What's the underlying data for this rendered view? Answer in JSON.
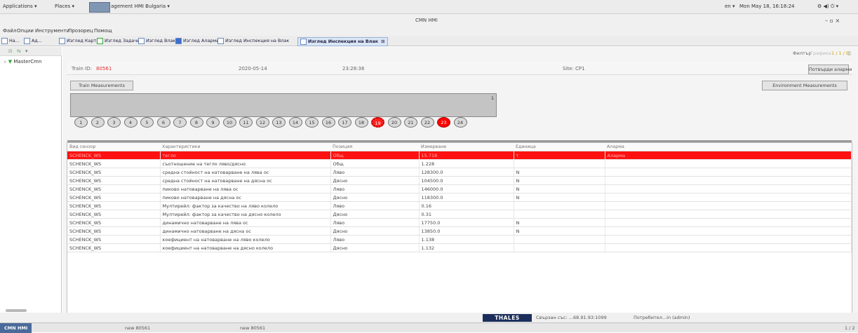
{
  "topbar": {
    "applications": "Applications ▾",
    "places": "Places ▾",
    "window_title": "agement HMI Bulgaria ▾",
    "lang": "en ▾",
    "clock": "Mon May 18, 16:18:24",
    "tray": "⚙ ◀) ⏻ ▾"
  },
  "titlebar": {
    "title": "CMN HMI",
    "controls": "–  ▫  ×"
  },
  "menu": [
    "Файл",
    "Опции",
    "Инструменти",
    "Прозорец",
    "Помощ"
  ],
  "tabs": [
    "Изглед Карта",
    "Изглед Задачи",
    "Изглед Влак",
    "Изглед Аларми",
    "Изглед Инспекция на Влак",
    "Изглед Инспекция на Влак"
  ],
  "left_tabs": [
    "На...",
    "Ад..."
  ],
  "tree": {
    "root": "MasterCmn"
  },
  "filter": {
    "label": "Филтър",
    "graphs": "Графика",
    "page": "1 / 1 / 0"
  },
  "train": {
    "label": "Train ID:",
    "id": "80561",
    "date": "2020-05-14",
    "time": "23:28:36",
    "site": "Site: CP1",
    "confirm_alarms": "Потвърди аларми"
  },
  "buttons": {
    "train_meas": "Train Measurements",
    "env_meas": "Environment Measurements"
  },
  "wagon": {
    "number": "1"
  },
  "axles": [
    {
      "n": "1",
      "state": "normal"
    },
    {
      "n": "2",
      "state": "normal"
    },
    {
      "n": "3",
      "state": "normal"
    },
    {
      "n": "4",
      "state": "normal"
    },
    {
      "n": "5",
      "state": "normal"
    },
    {
      "n": "6",
      "state": "normal"
    },
    {
      "n": "7",
      "state": "normal"
    },
    {
      "n": "8",
      "state": "normal"
    },
    {
      "n": "9",
      "state": "normal"
    },
    {
      "n": "10",
      "state": "normal"
    },
    {
      "n": "11",
      "state": "normal"
    },
    {
      "n": "12",
      "state": "normal"
    },
    {
      "n": "13",
      "state": "normal"
    },
    {
      "n": "14",
      "state": "normal"
    },
    {
      "n": "15",
      "state": "normal"
    },
    {
      "n": "16",
      "state": "normal"
    },
    {
      "n": "17",
      "state": "normal"
    },
    {
      "n": "18",
      "state": "normal"
    },
    {
      "n": "19",
      "state": "burst"
    },
    {
      "n": "20",
      "state": "normal"
    },
    {
      "n": "21",
      "state": "normal"
    },
    {
      "n": "22",
      "state": "normal"
    },
    {
      "n": "23",
      "state": "red"
    },
    {
      "n": "24",
      "state": "normal"
    }
  ],
  "table": {
    "columns": [
      "Вид сензор",
      "Характеристики",
      "Позиция",
      "Измерване",
      "Единица",
      "Аларма"
    ],
    "rows": [
      [
        "SCHENCK_WS",
        "тегло",
        "Общ",
        "15.718",
        "т",
        "Аларма"
      ],
      [
        "SCHENCK_WS",
        "съотношение на тегло ляво/дясно",
        "Общ",
        "1.228",
        "",
        ""
      ],
      [
        "SCHENCK_WS",
        "средна стойност на натоварване на лява ос",
        "Ляво",
        "128300.0",
        "N",
        ""
      ],
      [
        "SCHENCK_WS",
        "средна стойност на натоварване на дясна ос",
        "Дясно",
        "104500.0",
        "N",
        ""
      ],
      [
        "SCHENCK_WS",
        "пиково натоварване на лява ос",
        "Ляво",
        "146000.0",
        "N",
        ""
      ],
      [
        "SCHENCK_WS",
        "пиково натоварване на дясна ос",
        "Дясно",
        "118300.0",
        "N",
        ""
      ],
      [
        "SCHENCK_WS",
        "Мултирейл: фактор за качество на ляво колело",
        "Ляво",
        "0.16",
        "",
        ""
      ],
      [
        "SCHENCK_WS",
        "Мултирейл: фактор за качество на дясно колело",
        "Дясно",
        "0.31",
        "",
        ""
      ],
      [
        "SCHENCK_WS",
        "динамично натоварване на лява ос",
        "Ляво",
        "17750.0",
        "N",
        ""
      ],
      [
        "SCHENCK_WS",
        "динамично натоварване на дясна ос",
        "Дясно",
        "13850.0",
        "N",
        ""
      ],
      [
        "SCHENCK_WS",
        "коефициент на натоварване на ляво колело",
        "Ляво",
        "1.138",
        "",
        ""
      ],
      [
        "SCHENCK_WS",
        "коефициент на натоварване на дясно колело",
        "Дясно",
        "1.132",
        "",
        ""
      ]
    ]
  },
  "status": {
    "brand": "THALES",
    "connected": "Свързан със: ...68.91.93:1099",
    "user": "Потребител...in (admin)"
  },
  "taskbar": {
    "app": "CMN HMI",
    "item1": "new 80561",
    "item2": "new 80561",
    "pager": "1 / 2"
  },
  "colors": {
    "alarm": "#ff1111",
    "brand": "#1c2f5b"
  }
}
